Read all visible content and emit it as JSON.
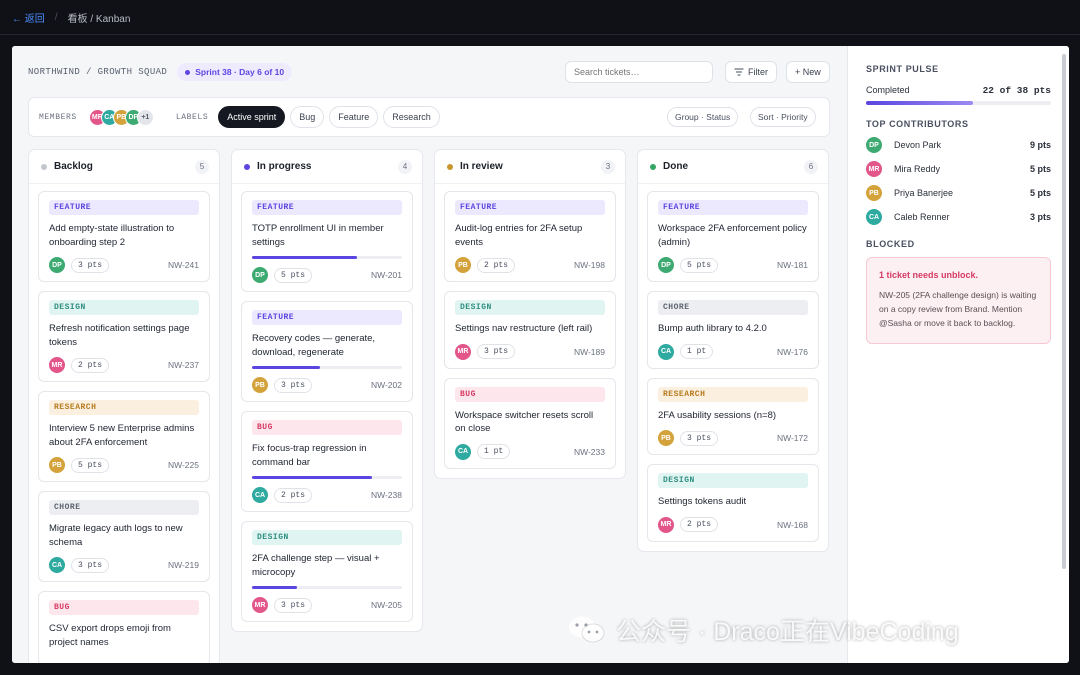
{
  "topbar": {
    "back_label": "← 返回",
    "separator": "/",
    "breadcrumb": "看板 / Kanban"
  },
  "header": {
    "squad": "NORTHWIND / GROWTH SQUAD",
    "sprint_badge": "Sprint 38 · Day 6 of 10",
    "search_placeholder": "Search tickets…",
    "filter_label": "Filter",
    "new_label": "+ New"
  },
  "filters": {
    "members_label": "MEMBERS",
    "members": [
      {
        "initials": "MR",
        "color": "#e2568a"
      },
      {
        "initials": "CA",
        "color": "#2eaaa0"
      },
      {
        "initials": "PB",
        "color": "#d4a23a"
      },
      {
        "initials": "DP",
        "color": "#3daa72"
      }
    ],
    "members_more": "+1",
    "labels_label": "LABELS",
    "chips": [
      "Active sprint",
      "Bug",
      "Feature",
      "Research"
    ],
    "group": "Group · Status",
    "sort": "Sort · Priority"
  },
  "columns": [
    {
      "title": "Backlog",
      "count": "5",
      "dot_color": "#c3c6cd",
      "cards": [
        {
          "tag": "FEATURE",
          "kind": "feature",
          "title": "Add empty-state illustration to onboarding step 2",
          "avatar": "DP",
          "pts": "3 pts",
          "id": "NW-241"
        },
        {
          "tag": "DESIGN",
          "kind": "design",
          "title": "Refresh notification settings page tokens",
          "avatar": "MR",
          "pts": "2 pts",
          "id": "NW-237"
        },
        {
          "tag": "RESEARCH",
          "kind": "research",
          "title": "Interview 5 new Enterprise admins about 2FA enforcement",
          "avatar": "PB",
          "pts": "5 pts",
          "id": "NW-225"
        },
        {
          "tag": "CHORE",
          "kind": "chore",
          "title": "Migrate legacy auth logs to new schema",
          "avatar": "CA",
          "pts": "3 pts",
          "id": "NW-219"
        },
        {
          "tag": "BUG",
          "kind": "bug",
          "title": "CSV export drops emoji from project names",
          "avatar": "",
          "pts": "",
          "id": ""
        }
      ]
    },
    {
      "title": "In progress",
      "count": "4",
      "dot_color": "#5b45e0",
      "cards": [
        {
          "tag": "FEATURE",
          "kind": "feature",
          "title": "TOTP enrollment UI in member settings",
          "progress": 0.7,
          "avatar": "DP",
          "pts": "5 pts",
          "id": "NW-201"
        },
        {
          "tag": "FEATURE",
          "kind": "feature",
          "title": "Recovery codes — generate, download, regenerate",
          "progress": 0.45,
          "avatar": "PB",
          "pts": "3 pts",
          "id": "NW-202"
        },
        {
          "tag": "BUG",
          "kind": "bug",
          "title": "Fix focus-trap regression in command bar",
          "progress": 0.8,
          "avatar": "CA",
          "pts": "2 pts",
          "id": "NW-238"
        },
        {
          "tag": "DESIGN",
          "kind": "design",
          "title": "2FA challenge step — visual + microcopy",
          "progress": 0.3,
          "avatar": "MR",
          "pts": "3 pts",
          "id": "NW-205"
        }
      ]
    },
    {
      "title": "In review",
      "count": "3",
      "dot_color": "#c9962e",
      "cards": [
        {
          "tag": "FEATURE",
          "kind": "feature",
          "title": "Audit-log entries for 2FA setup events",
          "avatar": "PB",
          "pts": "2 pts",
          "id": "NW-198"
        },
        {
          "tag": "DESIGN",
          "kind": "design",
          "title": "Settings nav restructure (left rail)",
          "avatar": "MR",
          "pts": "3 pts",
          "id": "NW-189"
        },
        {
          "tag": "BUG",
          "kind": "bug",
          "title": "Workspace switcher resets scroll on close",
          "avatar": "CA",
          "pts": "1 pt",
          "id": "NW-233"
        }
      ]
    },
    {
      "title": "Done",
      "count": "6",
      "dot_color": "#35a564",
      "cards": [
        {
          "tag": "FEATURE",
          "kind": "feature",
          "title": "Workspace 2FA enforcement policy (admin)",
          "avatar": "DP",
          "pts": "5 pts",
          "id": "NW-181"
        },
        {
          "tag": "CHORE",
          "kind": "chore",
          "title": "Bump auth library to 4.2.0",
          "avatar": "CA",
          "pts": "1 pt",
          "id": "NW-176"
        },
        {
          "tag": "RESEARCH",
          "kind": "research",
          "title": "2FA usability sessions (n=8)",
          "avatar": "PB",
          "pts": "3 pts",
          "id": "NW-172"
        },
        {
          "tag": "DESIGN",
          "kind": "design",
          "title": "Settings tokens audit",
          "avatar": "MR",
          "pts": "2 pts",
          "id": "NW-168"
        }
      ]
    }
  ],
  "avatar_colors": {
    "DP": "#3daa72",
    "MR": "#e2568a",
    "PB": "#d4a23a",
    "CA": "#2eaaa0"
  },
  "sidebar": {
    "pulse_title": "SPRINT PULSE",
    "completed_label": "Completed",
    "completed_value": "22 of 38 pts",
    "completed_fraction": 0.58,
    "contributors_title": "TOP CONTRIBUTORS",
    "contributors": [
      {
        "initials": "DP",
        "name": "Devon Park",
        "pts": "9 pts"
      },
      {
        "initials": "MR",
        "name": "Mira Reddy",
        "pts": "5 pts"
      },
      {
        "initials": "PB",
        "name": "Priya Banerjee",
        "pts": "5 pts"
      },
      {
        "initials": "CA",
        "name": "Caleb Renner",
        "pts": "3 pts"
      }
    ],
    "blocked_title": "BLOCKED",
    "blocked_headline": "1 ticket needs unblock.",
    "blocked_text": "NW-205 (2FA challenge design) is waiting on a copy review from Brand. Mention @Sasha or move it back to backlog."
  },
  "watermark": "公众号 · Draco正在VibeCoding"
}
